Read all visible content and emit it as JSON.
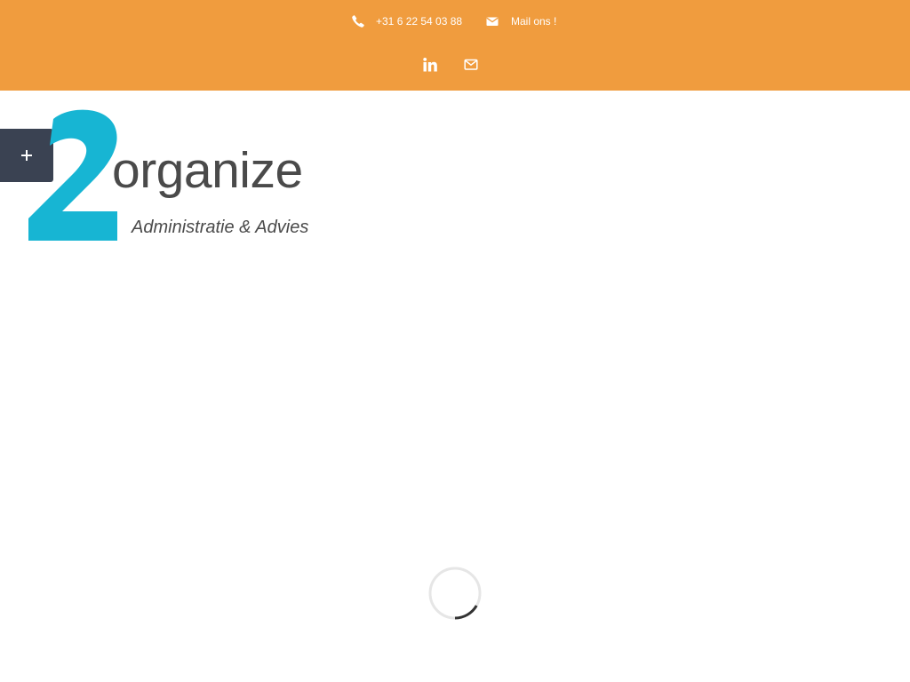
{
  "topbar": {
    "phone": "+31 6 22 54 03 88",
    "mail_label": "Mail ons !",
    "icons": {
      "phone": "phone-icon",
      "mail": "envelope-icon",
      "linkedin": "linkedin-icon",
      "email": "envelope-outline-icon"
    },
    "background_color": "#f09c3e"
  },
  "toggle": {
    "icon": "plus-icon",
    "background_color": "#3a4252"
  },
  "logo": {
    "wordmark": "organize",
    "tagline": "Administratie & Advies",
    "brand_color": "#17b5d3",
    "text_color": "#4a4a4a"
  },
  "loader": {
    "icon": "loading-spinner-icon"
  }
}
